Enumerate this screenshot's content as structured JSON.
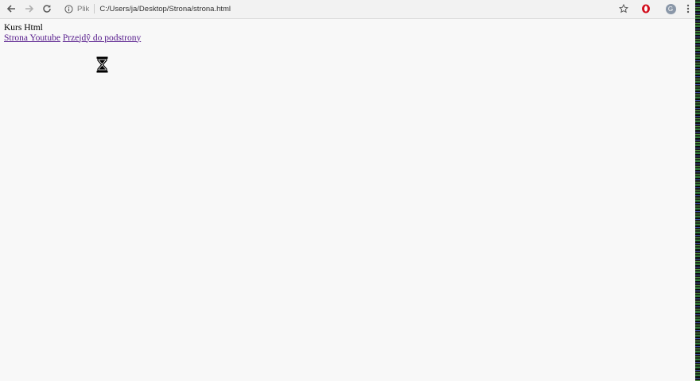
{
  "browser": {
    "security_label": "Plik",
    "url": "C:/Users/ja/Desktop/Strona/strona.html",
    "profile_initial": "G",
    "icons": {
      "back": "back-arrow-icon",
      "forward": "forward-arrow-icon",
      "reload": "reload-icon",
      "info": "info-icon",
      "bookmark": "star-icon",
      "opera": "opera-icon",
      "menu": "kebab-menu-icon"
    },
    "colors": {
      "opera": "#d20f1e",
      "link_visited": "#551a8b"
    }
  },
  "page": {
    "heading": "Kurs Html",
    "links": [
      {
        "label": "Strona Youtube"
      },
      {
        "label": "Przejdŷ do podstrony"
      }
    ],
    "cursor_icon": "hourglass-cursor-icon"
  }
}
